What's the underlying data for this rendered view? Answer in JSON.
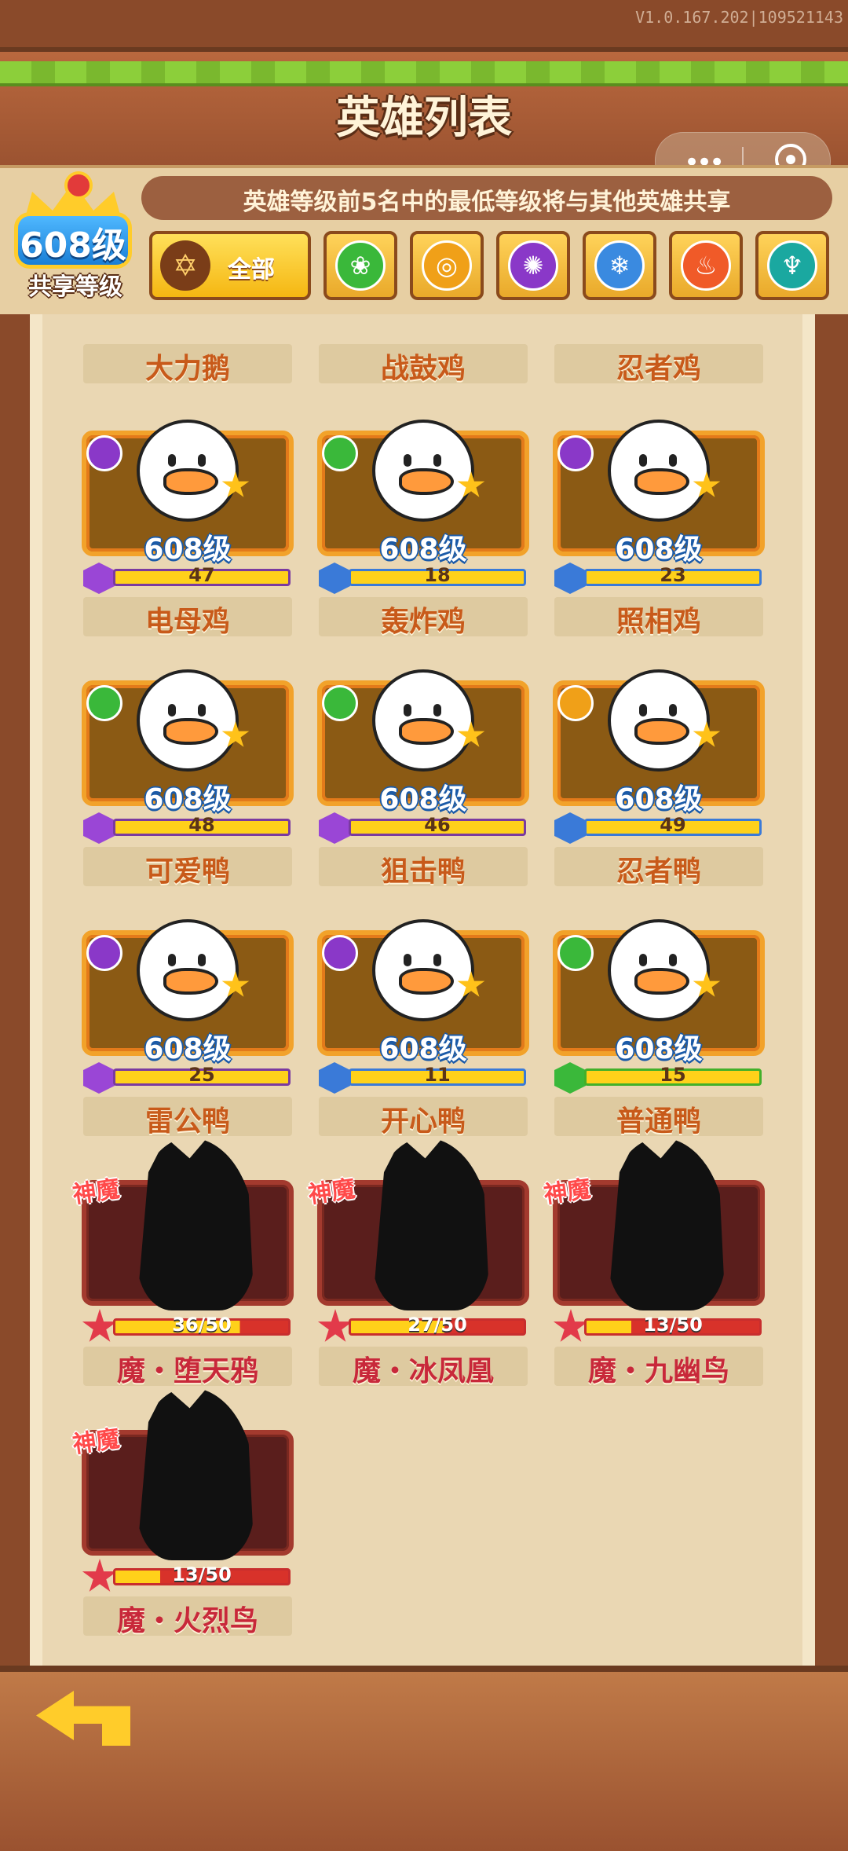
{
  "version": "V1.0.167.202|109521143",
  "title": "英雄列表",
  "share_info": "英雄等级前5名中的最低等级将与其他英雄共享",
  "shared_level": {
    "value": "608级",
    "label": "共享等级"
  },
  "filters": {
    "all_label": "全部",
    "items": [
      {
        "name": "nature",
        "icon": "leaf-icon",
        "color": "#3ab83a",
        "glyph": "❀"
      },
      {
        "name": "sun",
        "icon": "sun-icon",
        "color": "#f0a018",
        "glyph": "◎"
      },
      {
        "name": "shadow",
        "icon": "vortex-icon",
        "color": "#8a38c8",
        "glyph": "✺"
      },
      {
        "name": "ice",
        "icon": "snowflake-icon",
        "color": "#3a8ae0",
        "glyph": "❄"
      },
      {
        "name": "fire",
        "icon": "flame-icon",
        "color": "#f05a28",
        "glyph": "♨"
      },
      {
        "name": "sea",
        "icon": "trident-icon",
        "color": "#1aa8a0",
        "glyph": "♆"
      }
    ]
  },
  "partial_row": [
    "大力鹅",
    "战鼓鸡",
    "忍者鸡"
  ],
  "heroes": [
    {
      "name": "电母鸡",
      "level": "608级",
      "count": "47",
      "gem": "purple",
      "elem": "#8a38c8"
    },
    {
      "name": "轰炸鸡",
      "level": "608级",
      "count": "18",
      "gem": "blue",
      "elem": "#3ab83a"
    },
    {
      "name": "照相鸡",
      "level": "608级",
      "count": "23",
      "gem": "blue",
      "elem": "#8a38c8"
    },
    {
      "name": "可爱鸭",
      "level": "608级",
      "count": "48",
      "gem": "purple",
      "elem": "#3ab83a"
    },
    {
      "name": "狙击鸭",
      "level": "608级",
      "count": "46",
      "gem": "purple",
      "elem": "#3ab83a"
    },
    {
      "name": "忍者鸭",
      "level": "608级",
      "count": "49",
      "gem": "blue",
      "elem": "#f0a018"
    },
    {
      "name": "雷公鸭",
      "level": "608级",
      "count": "25",
      "gem": "purple",
      "elem": "#8a38c8"
    },
    {
      "name": "开心鸭",
      "level": "608级",
      "count": "11",
      "gem": "blue",
      "elem": "#8a38c8"
    },
    {
      "name": "普通鸭",
      "level": "608级",
      "count": "15",
      "gem": "green",
      "elem": "#3ab83a"
    }
  ],
  "locked_heroes": [
    {
      "name": "魔・堕天鸦",
      "progress": "36/50",
      "fill": 0.72,
      "tag": "神魔"
    },
    {
      "name": "魔・冰凤凰",
      "progress": "27/50",
      "fill": 0.54,
      "tag": "神魔"
    },
    {
      "name": "魔・九幽鸟",
      "progress": "13/50",
      "fill": 0.26,
      "tag": "神魔"
    },
    {
      "name": "魔・火烈鸟",
      "progress": "13/50",
      "fill": 0.26,
      "tag": "神魔"
    }
  ]
}
